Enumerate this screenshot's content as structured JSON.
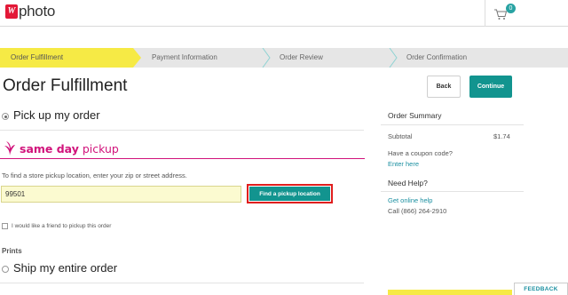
{
  "header": {
    "logo_mark": "W",
    "logo_text": "photo",
    "cart_count": "0"
  },
  "steps": [
    {
      "label": "Order Fulfillment",
      "active": true
    },
    {
      "label": "Payment Information",
      "active": false
    },
    {
      "label": "Order Review",
      "active": false
    },
    {
      "label": "Order Confirmation",
      "active": false
    }
  ],
  "page": {
    "title": "Order Fulfillment",
    "back_label": "Back",
    "continue_label": "Continue"
  },
  "fulfillment": {
    "pickup_label": "Pick up my order",
    "pickup_selected": true,
    "same_day_bold": "same day",
    "same_day_rest": " pickup",
    "find_instructions": "To find a store pickup location, enter your zip or street address.",
    "zip_value": "99501",
    "find_button_label": "Find a pickup location",
    "friend_label": "I would like a friend to pickup this order",
    "prints_label": "Prints",
    "ship_label": "Ship my entire order"
  },
  "summary": {
    "title": "Order Summary",
    "subtotal_label": "Subtotal",
    "subtotal_value": "$1.74",
    "coupon_question": "Have a coupon code?",
    "coupon_link": "Enter here"
  },
  "help": {
    "title": "Need Help?",
    "link": "Get online help",
    "phone": "Call (866) 264-2910"
  },
  "feedback_label": "FEEDBACK",
  "colors": {
    "accent": "#12948f",
    "step_active": "#f6ea45",
    "brand_red": "#e31837",
    "same_day_pink": "#d1137b"
  }
}
